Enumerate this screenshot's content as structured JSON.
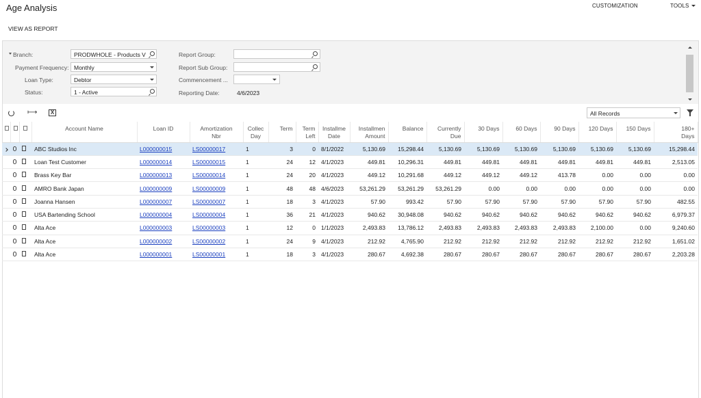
{
  "header": {
    "title": "Age Analysis",
    "customization_label": "CUSTOMIZATION",
    "tools_label": "TOOLS",
    "view_as_report_label": "VIEW AS REPORT"
  },
  "filters": {
    "branch_label": "Branch:",
    "branch_value": "PRODWHOLE - Products V",
    "payment_frequency_label": "Payment Frequency:",
    "payment_frequency_value": "Monthly",
    "loan_type_label": "Loan Type:",
    "loan_type_value": "Debtor",
    "status_label": "Status:",
    "status_value": "1 - Active",
    "report_group_label": "Report Group:",
    "report_group_value": "",
    "report_sub_group_label": "Report Sub Group:",
    "report_sub_group_value": "",
    "commencement_label": "Commencement ...",
    "commencement_value": "",
    "reporting_date_label": "Reporting Date:",
    "reporting_date_value": "4/6/2023"
  },
  "toolbar": {
    "records_value": "All Records",
    "excel_glyph": "X"
  },
  "columns": [
    {
      "key": "account_name",
      "label": "Account Name"
    },
    {
      "key": "loan_id",
      "label": "Loan ID"
    },
    {
      "key": "amort",
      "label": "Amortization\nNbr"
    },
    {
      "key": "collect_day",
      "label": "Collec\nDay"
    },
    {
      "key": "term",
      "label": "Term"
    },
    {
      "key": "term_left",
      "label": "Term\nLeft"
    },
    {
      "key": "inst_date",
      "label": "Installme\nDate"
    },
    {
      "key": "inst_amount",
      "label": "Installmen\nAmount"
    },
    {
      "key": "balance",
      "label": "Balance"
    },
    {
      "key": "currently_due",
      "label": "Currently\nDue"
    },
    {
      "key": "d30",
      "label": "30 Days"
    },
    {
      "key": "d60",
      "label": "60 Days"
    },
    {
      "key": "d90",
      "label": "90 Days"
    },
    {
      "key": "d120",
      "label": "120 Days"
    },
    {
      "key": "d150",
      "label": "150 Days"
    },
    {
      "key": "d180",
      "label": "180+\nDays"
    }
  ],
  "rows": [
    [
      "ABC Studios Inc",
      "L000000015",
      "LS00000017",
      "1",
      "3",
      "0",
      "8/1/2022",
      "5,130.69",
      "15,298.44",
      "5,130.69",
      "5,130.69",
      "5,130.69",
      "5,130.69",
      "5,130.69",
      "5,130.69",
      "15,298.44"
    ],
    [
      "Loan Test Customer",
      "L000000014",
      "LS00000015",
      "1",
      "24",
      "12",
      "4/1/2023",
      "449.81",
      "10,296.31",
      "449.81",
      "449.81",
      "449.81",
      "449.81",
      "449.81",
      "449.81",
      "2,513.05"
    ],
    [
      "Brass Key Bar",
      "L000000013",
      "LS00000014",
      "1",
      "24",
      "20",
      "4/1/2023",
      "449.12",
      "10,291.68",
      "449.12",
      "449.12",
      "449.12",
      "413.78",
      "0.00",
      "0.00",
      "0.00"
    ],
    [
      "AMRO Bank Japan",
      "L000000009",
      "LS00000009",
      "1",
      "48",
      "48",
      "4/6/2023",
      "53,261.29",
      "53,261.29",
      "53,261.29",
      "0.00",
      "0.00",
      "0.00",
      "0.00",
      "0.00",
      "0.00"
    ],
    [
      "Joanna Hansen",
      "L000000007",
      "LS00000007",
      "1",
      "18",
      "3",
      "4/1/2023",
      "57.90",
      "993.42",
      "57.90",
      "57.90",
      "57.90",
      "57.90",
      "57.90",
      "57.90",
      "482.55"
    ],
    [
      "USA Bartending School",
      "L000000004",
      "LS00000004",
      "1",
      "36",
      "21",
      "4/1/2023",
      "940.62",
      "30,948.08",
      "940.62",
      "940.62",
      "940.62",
      "940.62",
      "940.62",
      "940.62",
      "6,979.37"
    ],
    [
      "Alta Ace",
      "L000000003",
      "LS00000003",
      "1",
      "12",
      "0",
      "1/1/2023",
      "2,493.83",
      "13,786.12",
      "2,493.83",
      "2,493.83",
      "2,493.83",
      "2,493.83",
      "2,100.00",
      "0.00",
      "9,240.60"
    ],
    [
      "Alta Ace",
      "L000000002",
      "LS00000002",
      "1",
      "24",
      "9",
      "4/1/2023",
      "212.92",
      "4,765.90",
      "212.92",
      "212.92",
      "212.92",
      "212.92",
      "212.92",
      "212.92",
      "1,651.02"
    ],
    [
      "Alta Ace",
      "L000000001",
      "LS00000001",
      "1",
      "18",
      "3",
      "4/1/2023",
      "280.67",
      "4,692.38",
      "280.67",
      "280.67",
      "280.67",
      "280.67",
      "280.67",
      "280.67",
      "2,203.28"
    ]
  ]
}
